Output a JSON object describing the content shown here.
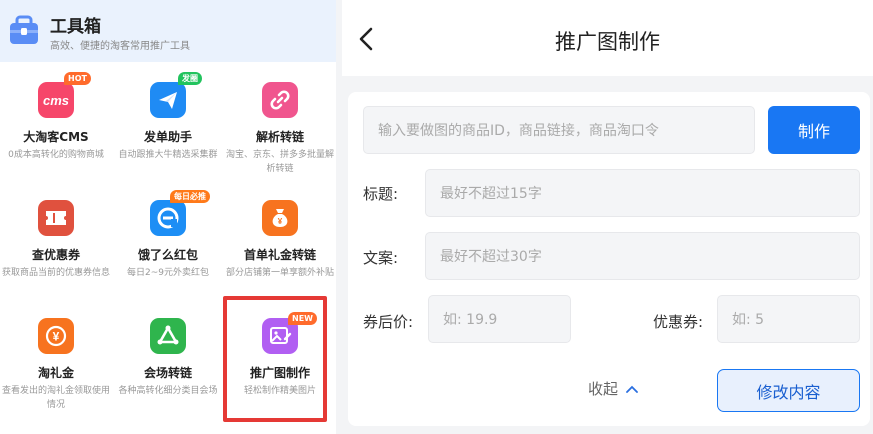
{
  "toolbox": {
    "title": "工具箱",
    "subtitle": "高效、便捷的淘客常用推广工具"
  },
  "tools": [
    {
      "name": "大淘客CMS",
      "desc": "0成本高转化的购物商城",
      "badge": "HOT",
      "badge_color": "#ff6b2c",
      "icon": "cms-icon",
      "icon_text": "cms",
      "color": "#f6466a"
    },
    {
      "name": "发单助手",
      "desc": "自动跟推大牛精选采集群",
      "badge": "发圈",
      "badge_color": "#22c35e",
      "icon": "paper-plane-icon",
      "color": "#1f8bf4"
    },
    {
      "name": "解析转链",
      "desc": "淘宝、京东、拼多多批量解析转链",
      "badge": "",
      "icon": "link-icon",
      "color": "#f0558e"
    },
    {
      "name": "查优惠券",
      "desc": "获取商品当前的优惠券信息",
      "badge": "",
      "icon": "coupon-ticket-icon",
      "color": "#e0513e"
    },
    {
      "name": "饿了么红包",
      "desc": "每日2~9元外卖红包",
      "badge": "每日必推",
      "badge_color": "#ff7a1a",
      "icon": "eleme-icon",
      "color": "#1d8ef5"
    },
    {
      "name": "首单礼金转链",
      "desc": "部分店铺第一单享额外补贴",
      "badge": "",
      "icon": "money-bag-icon",
      "color": "#f7731f"
    },
    {
      "name": "淘礼金",
      "desc": "查看发出的淘礼金领取使用情况",
      "badge": "",
      "icon": "yen-coin-icon",
      "color": "#f7731f"
    },
    {
      "name": "会场转链",
      "desc": "各种高转化细分类目会场",
      "badge": "",
      "icon": "recycle-icon",
      "color": "#2fb54d"
    },
    {
      "name": "推广图制作",
      "desc": "轻松制作精美图片",
      "badge": "NEW",
      "badge_color": "#ff6b2c",
      "icon": "image-edit-icon",
      "color": "#b15ff2"
    }
  ],
  "page": {
    "title": "推广图制作"
  },
  "form": {
    "link_placeholder": "输入要做图的商品ID，商品链接，商品淘口令",
    "make_label": "制作",
    "title_label": "标题:",
    "title_placeholder": "最好不超过15字",
    "copy_label": "文案:",
    "copy_placeholder": "最好不超过30字",
    "price_label": "券后价:",
    "price_placeholder": "如: 19.9",
    "coupon_label": "优惠券:",
    "coupon_placeholder": "如: 5",
    "collapse_label": "收起",
    "modify_label": "修改内容"
  },
  "colors": {
    "accent": "#1977f3",
    "highlight_border": "#e53935"
  }
}
